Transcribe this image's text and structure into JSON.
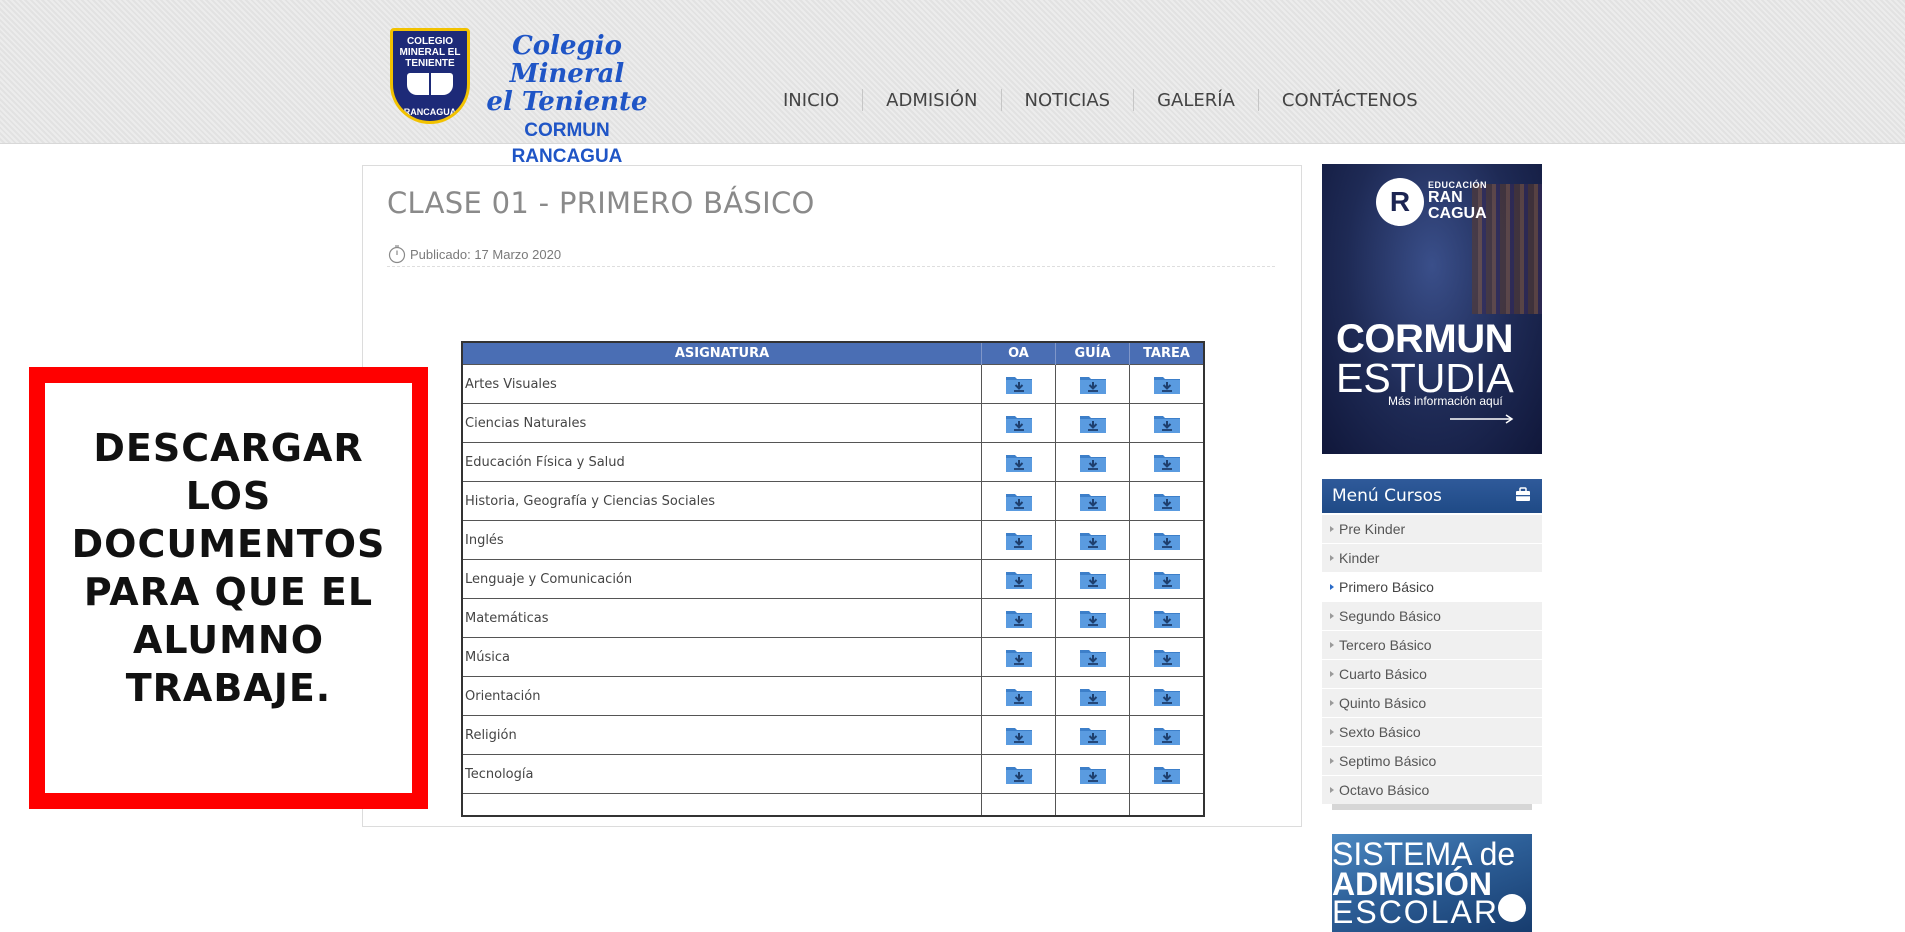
{
  "header": {
    "logo": {
      "badge_top": "COLEGIO MINERAL EL TENIENTE",
      "badge_bottom": "RANCAGUA",
      "line1": "Colegio Mineral",
      "line2": "el Teniente",
      "line3": "CORMUN RANCAGUA"
    },
    "nav": [
      {
        "label": "INICIO"
      },
      {
        "label": "ADMISIÓN"
      },
      {
        "label": "NOTICIAS"
      },
      {
        "label": "GALERÍA"
      },
      {
        "label": "CONTÁCTENOS"
      }
    ]
  },
  "post": {
    "title": "CLASE 01 - PRIMERO BÁSICO",
    "published": "Publicado: 17 Marzo 2020"
  },
  "table": {
    "headers": [
      "ASIGNATURA",
      "OA",
      "GUÍA",
      "TAREA"
    ],
    "rows": [
      {
        "subject": "Artes Visuales"
      },
      {
        "subject": "Ciencias Naturales"
      },
      {
        "subject": "Educación Física y Salud"
      },
      {
        "subject": "Historia, Geografía y Ciencias Sociales"
      },
      {
        "subject": "Inglés"
      },
      {
        "subject": "Lenguaje y Comunicación"
      },
      {
        "subject": "Matemáticas"
      },
      {
        "subject": "Música"
      },
      {
        "subject": "Orientación"
      },
      {
        "subject": "Religión"
      },
      {
        "subject": "Tecnología"
      }
    ],
    "icon": "folder-download-icon"
  },
  "callout": {
    "text": "DESCARGAR LOS DOCUMENTOS PARA QUE EL ALUMNO TRABAJE.",
    "border_color": "#ff0000"
  },
  "sidebar": {
    "banner_cormun": {
      "badge_letter": "R",
      "brand_small": "EDUCACIÓN",
      "brand_l1": "RAN",
      "brand_l2": "CAGUA",
      "title_l1": "CORMUN",
      "title_l2": "ESTUDIA",
      "info": "Más información aquí"
    },
    "menu": {
      "title": "Menú Cursos",
      "items": [
        {
          "label": "Pre Kinder",
          "active": false
        },
        {
          "label": "Kinder",
          "active": false
        },
        {
          "label": "Primero Básico",
          "active": true
        },
        {
          "label": "Segundo Básico",
          "active": false
        },
        {
          "label": "Tercero Básico",
          "active": false
        },
        {
          "label": "Cuarto Básico",
          "active": false
        },
        {
          "label": "Quinto Básico",
          "active": false
        },
        {
          "label": "Sexto Básico",
          "active": false
        },
        {
          "label": "Septimo Básico",
          "active": false
        },
        {
          "label": "Octavo Básico",
          "active": false
        }
      ]
    },
    "banner_sae": {
      "line1": "SISTEMA de",
      "line2": "ADMISIÓN",
      "line3": "ESCOLAR"
    }
  },
  "colors": {
    "table_header": "#4a6eb4",
    "menu_header": "#2f5a9a",
    "logo_blue": "#1f55c6",
    "folder": "#4a90d9"
  }
}
